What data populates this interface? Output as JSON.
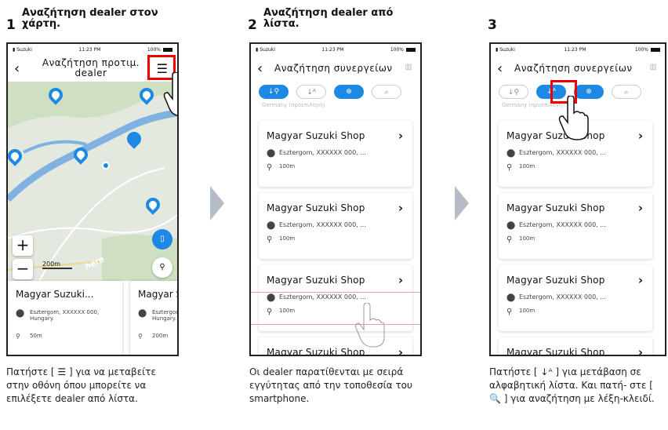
{
  "steps": [
    {
      "num": "1",
      "title": "Αναζήτηση dealer στον χάρτη.",
      "caption": "Πατήστε [ ☰ ] για να μεταβείτε στην οθόνη όπου μπορείτε να επιλέξετε dealer από λίστα."
    },
    {
      "num": "2",
      "title": "Αναζήτηση dealer από λίστα.",
      "caption": "Οι dealer παρατίθενται με σειρά εγγύτητας από την τοποθεσία του smartphone."
    },
    {
      "num": "3",
      "title": "",
      "caption": "Πατήστε [ ↓ᴬ ] για μετάβαση σε αλφαβητική λίστα. Και πατή- στε [ 🔍 ] για αναζήτηση με λέξη-κλειδί."
    }
  ],
  "status": {
    "carrier": "Suzuki",
    "time": "11:23 PM",
    "battery": "100%"
  },
  "screen1": {
    "title": "Αναζήτηση προτιμ. dealer",
    "scale": "200m",
    "cards": [
      {
        "name": "Magyar Suzuki...",
        "address": "Esztergom, XXXXXX 000, Hungary.",
        "distance": "50m"
      },
      {
        "name": "Magyar S",
        "address": "Esztergon Hungary.",
        "distance": "200m"
      }
    ]
  },
  "list": {
    "title": "Αναζήτηση συνεργείων",
    "country": "Germany (προεπιλογή)",
    "dealers": [
      {
        "name": "Magyar Suzuki Shop",
        "address": "Esztergom, XXXXXX 000, ...",
        "distance": "100m"
      },
      {
        "name": "Magyar Suzuki Shop",
        "address": "Esztergom, XXXXXX 000, ...",
        "distance": "100m"
      },
      {
        "name": "Magyar Suzuki Shop",
        "address": "Esztergom, XXXXXX 000, ...",
        "distance": "100m"
      },
      {
        "name": "Magyar Suzuki Shop",
        "address": "",
        "distance": ""
      }
    ]
  },
  "colors": {
    "accent": "#1e88e5",
    "highlight": "#e00000",
    "arrow": "#b5bcc6"
  }
}
